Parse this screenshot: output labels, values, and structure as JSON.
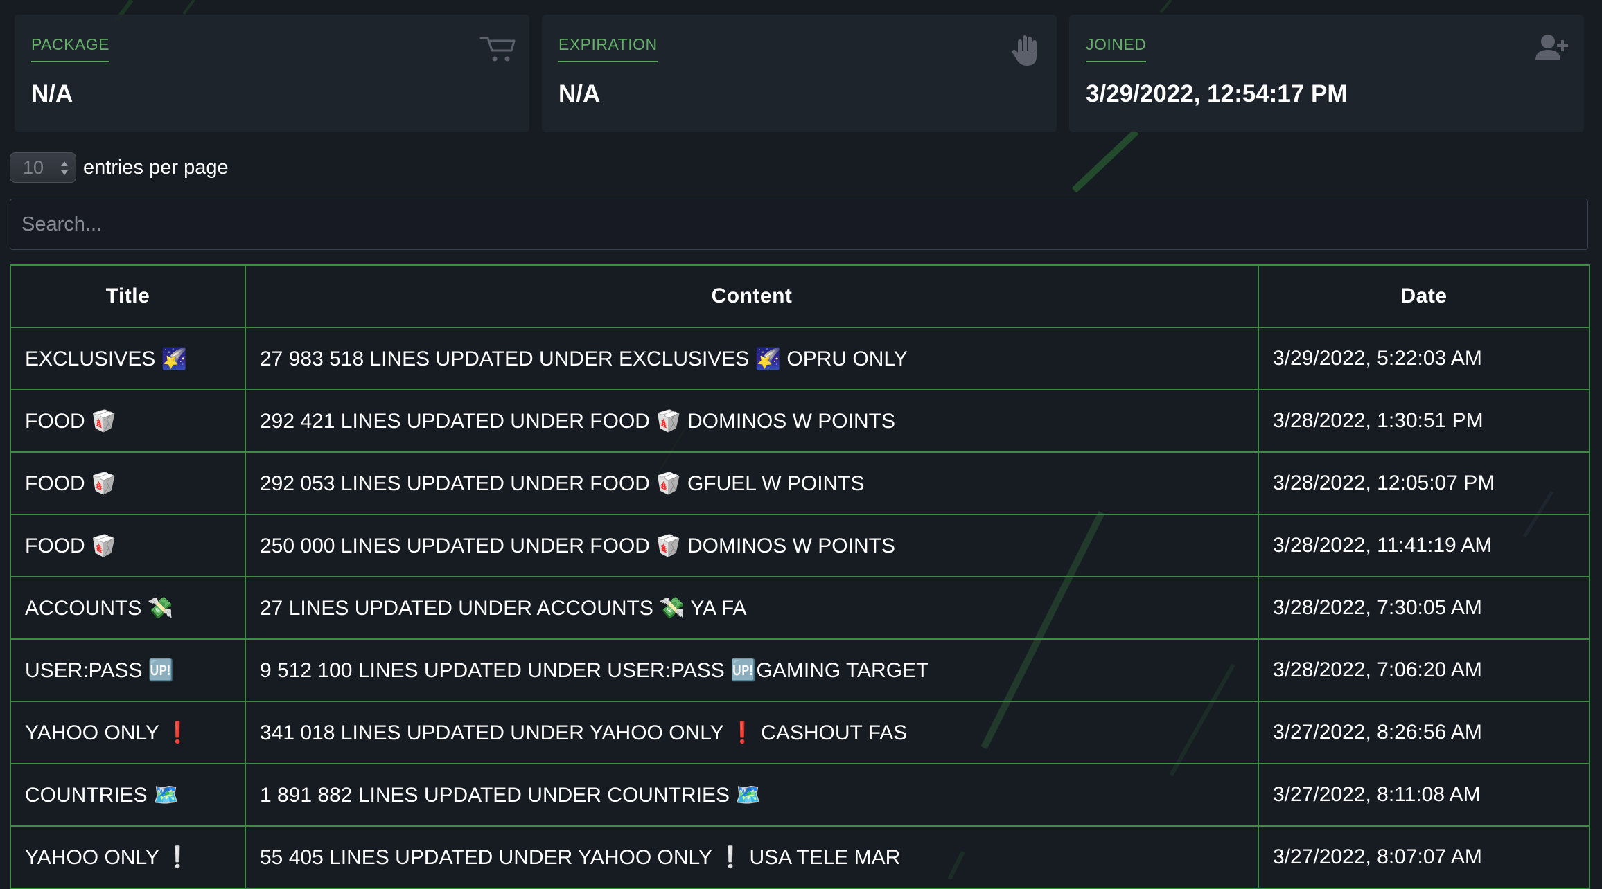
{
  "cards": [
    {
      "label": "PACKAGE",
      "value": "N/A",
      "icon": "cart-icon"
    },
    {
      "label": "EXPIRATION",
      "value": "N/A",
      "icon": "hand-icon"
    },
    {
      "label": "JOINED",
      "value": "3/29/2022, 12:54:17 PM",
      "icon": "add-user-icon"
    }
  ],
  "entries": {
    "value": "10",
    "label": "entries per page"
  },
  "search": {
    "placeholder": "Search..."
  },
  "table": {
    "headers": {
      "title": "Title",
      "content": "Content",
      "date": "Date"
    },
    "rows": [
      {
        "title": "EXCLUSIVES 🌠",
        "content": "27 983 518 LINES UPDATED UNDER EXCLUSIVES 🌠 OPRU ONLY",
        "date": "3/29/2022, 5:22:03 AM"
      },
      {
        "title": "FOOD 🥡",
        "content": "292 421 LINES UPDATED UNDER FOOD 🥡 DOMINOS W POINTS",
        "date": "3/28/2022, 1:30:51 PM"
      },
      {
        "title": "FOOD 🥡",
        "content": "292 053 LINES UPDATED UNDER FOOD 🥡 GFUEL W POINTS",
        "date": "3/28/2022, 12:05:07 PM"
      },
      {
        "title": "FOOD 🥡",
        "content": "250 000 LINES UPDATED UNDER FOOD 🥡 DOMINOS W POINTS",
        "date": "3/28/2022, 11:41:19 AM"
      },
      {
        "title": "ACCOUNTS 💸",
        "content": "27 LINES UPDATED UNDER ACCOUNTS 💸 YA FA",
        "date": "3/28/2022, 7:30:05 AM"
      },
      {
        "title": "USER:PASS 🆙",
        "content": "9 512 100 LINES UPDATED UNDER USER:PASS 🆙GAMING TARGET",
        "date": "3/28/2022, 7:06:20 AM"
      },
      {
        "title": "YAHOO ONLY ❗",
        "content": "341 018 LINES UPDATED UNDER YAHOO ONLY ❗ CASHOUT FAS",
        "date": "3/27/2022, 8:26:56 AM"
      },
      {
        "title": "COUNTRIES 🗺️",
        "content": "1 891 882 LINES UPDATED UNDER COUNTRIES 🗺️",
        "date": "3/27/2022, 8:11:08 AM"
      },
      {
        "title": "YAHOO ONLY ❕",
        "content": "55 405 LINES UPDATED UNDER YAHOO ONLY ❕ USA TELE MAR",
        "date": "3/27/2022, 8:07:07 AM"
      }
    ]
  }
}
